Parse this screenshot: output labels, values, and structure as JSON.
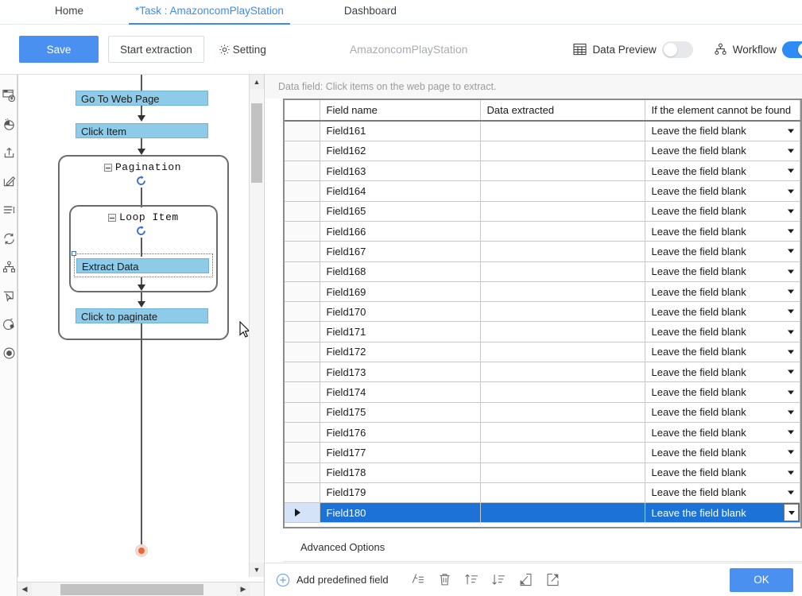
{
  "tabs": [
    {
      "label": "Home",
      "id": "home",
      "active": false
    },
    {
      "label": "*Task : AmazoncomPlayStation",
      "id": "task",
      "active": true
    },
    {
      "label": "Dashboard",
      "id": "dash",
      "active": false
    }
  ],
  "toolbar": {
    "save_label": "Save",
    "start_extraction_label": "Start extraction",
    "setting_label": "Setting",
    "setting_icon": "gear-icon",
    "task_name": "AmazoncomPlayStation",
    "data_preview_label": "Data Preview",
    "data_preview_icon": "table-grid-icon",
    "data_preview_on": false,
    "workflow_label": "Workflow",
    "workflow_icon": "hierarchy-icon",
    "workflow_on": true,
    "accent_color": "#4a90f0"
  },
  "icon_rail": [
    {
      "name": "open-web-page-icon"
    },
    {
      "name": "click-item-icon"
    },
    {
      "name": "enter-text-icon"
    },
    {
      "name": "edit-icon"
    },
    {
      "name": "select-list-icon"
    },
    {
      "name": "loop-icon"
    },
    {
      "name": "branch-icon"
    },
    {
      "name": "move-mouse-icon"
    },
    {
      "name": "capture-icon"
    },
    {
      "name": "end-icon"
    }
  ],
  "workflow": {
    "nodes": [
      {
        "id": "go-to-web-page",
        "label": "Go To Web Page"
      },
      {
        "id": "click-item",
        "label": "Click Item"
      },
      {
        "id": "extract-data",
        "label": "Extract Data",
        "selected": true
      },
      {
        "id": "click-to-paginate",
        "label": "Click to paginate"
      }
    ],
    "groups": [
      {
        "id": "pagination",
        "label": "Pagination"
      },
      {
        "id": "loop-item",
        "label": "Loop Item"
      }
    ],
    "end_node_color": "#e8663a",
    "node_color": "#8ecbe8"
  },
  "data_field": {
    "hint": "Data field: Click items on the web page to extract.",
    "columns": [
      {
        "key": "sel",
        "label": ""
      },
      {
        "key": "name",
        "label": "Field name"
      },
      {
        "key": "data",
        "label": "Data extracted"
      },
      {
        "key": "fallback",
        "label": "If the element cannot be found"
      }
    ],
    "rows": [
      {
        "name": "Field161",
        "data": "",
        "fallback": "Leave the field blank",
        "selected": false
      },
      {
        "name": "Field162",
        "data": "",
        "fallback": "Leave the field blank",
        "selected": false
      },
      {
        "name": "Field163",
        "data": "",
        "fallback": "Leave the field blank",
        "selected": false
      },
      {
        "name": "Field164",
        "data": "",
        "fallback": "Leave the field blank",
        "selected": false
      },
      {
        "name": "Field165",
        "data": "",
        "fallback": "Leave the field blank",
        "selected": false
      },
      {
        "name": "Field166",
        "data": "",
        "fallback": "Leave the field blank",
        "selected": false
      },
      {
        "name": "Field167",
        "data": "",
        "fallback": "Leave the field blank",
        "selected": false
      },
      {
        "name": "Field168",
        "data": "",
        "fallback": "Leave the field blank",
        "selected": false
      },
      {
        "name": "Field169",
        "data": "",
        "fallback": "Leave the field blank",
        "selected": false
      },
      {
        "name": "Field170",
        "data": "",
        "fallback": "Leave the field blank",
        "selected": false
      },
      {
        "name": "Field171",
        "data": "",
        "fallback": "Leave the field blank",
        "selected": false
      },
      {
        "name": "Field172",
        "data": "",
        "fallback": "Leave the field blank",
        "selected": false
      },
      {
        "name": "Field173",
        "data": "",
        "fallback": "Leave the field blank",
        "selected": false
      },
      {
        "name": "Field174",
        "data": "",
        "fallback": "Leave the field blank",
        "selected": false
      },
      {
        "name": "Field175",
        "data": "",
        "fallback": "Leave the field blank",
        "selected": false
      },
      {
        "name": "Field176",
        "data": "",
        "fallback": "Leave the field blank",
        "selected": false
      },
      {
        "name": "Field177",
        "data": "",
        "fallback": "Leave the field blank",
        "selected": false
      },
      {
        "name": "Field178",
        "data": "",
        "fallback": "Leave the field blank",
        "selected": false
      },
      {
        "name": "Field179",
        "data": "",
        "fallback": "Leave the field blank",
        "selected": false
      },
      {
        "name": "Field180",
        "data": "",
        "fallback": "Leave the field blank",
        "selected": true
      }
    ],
    "advanced_options_label": "Advanced Options",
    "add_predefined_field_label": "Add predefined field",
    "add_icon": "plus-circle-icon",
    "tool_icons": [
      {
        "name": "rename-field-icon"
      },
      {
        "name": "delete-field-icon"
      },
      {
        "name": "move-up-icon"
      },
      {
        "name": "move-down-icon"
      },
      {
        "name": "import-field-icon"
      },
      {
        "name": "export-field-icon"
      }
    ],
    "ok_label": "OK",
    "selected_row_color": "#1d72d8"
  }
}
